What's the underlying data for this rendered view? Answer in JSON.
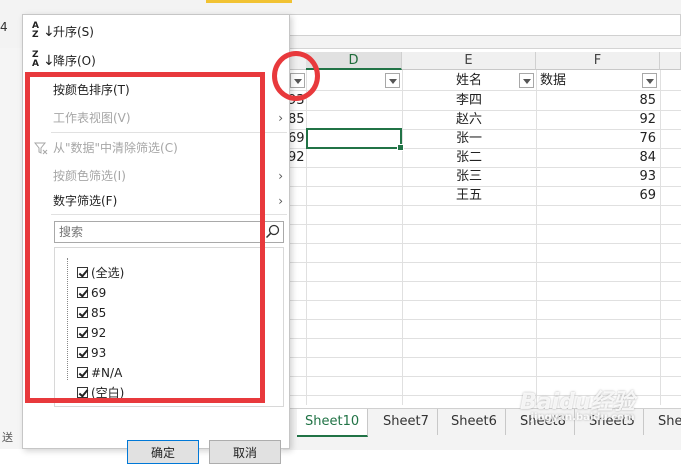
{
  "app": {
    "namebox_value": "4"
  },
  "sheet": {
    "columns": [
      {
        "name": "D",
        "selected": true
      },
      {
        "name": "E",
        "selected": false
      },
      {
        "name": "F",
        "selected": false
      }
    ],
    "partial_col_values": [
      "93",
      "85",
      "69",
      "92"
    ],
    "header_row": {
      "e": "姓名",
      "f": "数据"
    },
    "rows": [
      {
        "name": "李四",
        "value": "85"
      },
      {
        "name": "赵六",
        "value": "92"
      },
      {
        "name": "张一",
        "value": "76"
      },
      {
        "name": "张二",
        "value": "84"
      },
      {
        "name": "张三",
        "value": "93"
      },
      {
        "name": "王五",
        "value": "69"
      }
    ],
    "tabs": [
      "Sheet10",
      "Sheet7",
      "Sheet6",
      "Sheet8",
      "Sheet5",
      "She"
    ],
    "active_tab": "Sheet10"
  },
  "menu": {
    "sort_asc": "升序(S)",
    "sort_desc": "降序(O)",
    "sort_by_color": "按颜色排序(T)",
    "sheet_view": "工作表视图(V)",
    "clear_filter": "从\"数据\"中清除筛选(C)",
    "filter_by_color": "按颜色筛选(I)",
    "number_filter": "数字筛选(F)",
    "search_placeholder": "搜索",
    "items": [
      "(全选)",
      "69",
      "85",
      "92",
      "93",
      "#N/A",
      "(空白)"
    ],
    "ok": "确定",
    "cancel": "取消",
    "sort_icon_a": "A",
    "sort_icon_z": "Z"
  },
  "colors": {
    "accent": "#217346",
    "annotation": "#e8393c"
  },
  "watermark": {
    "brand": "Baidu",
    "sub": "经验",
    "url": "jingyan.baidu.com"
  }
}
